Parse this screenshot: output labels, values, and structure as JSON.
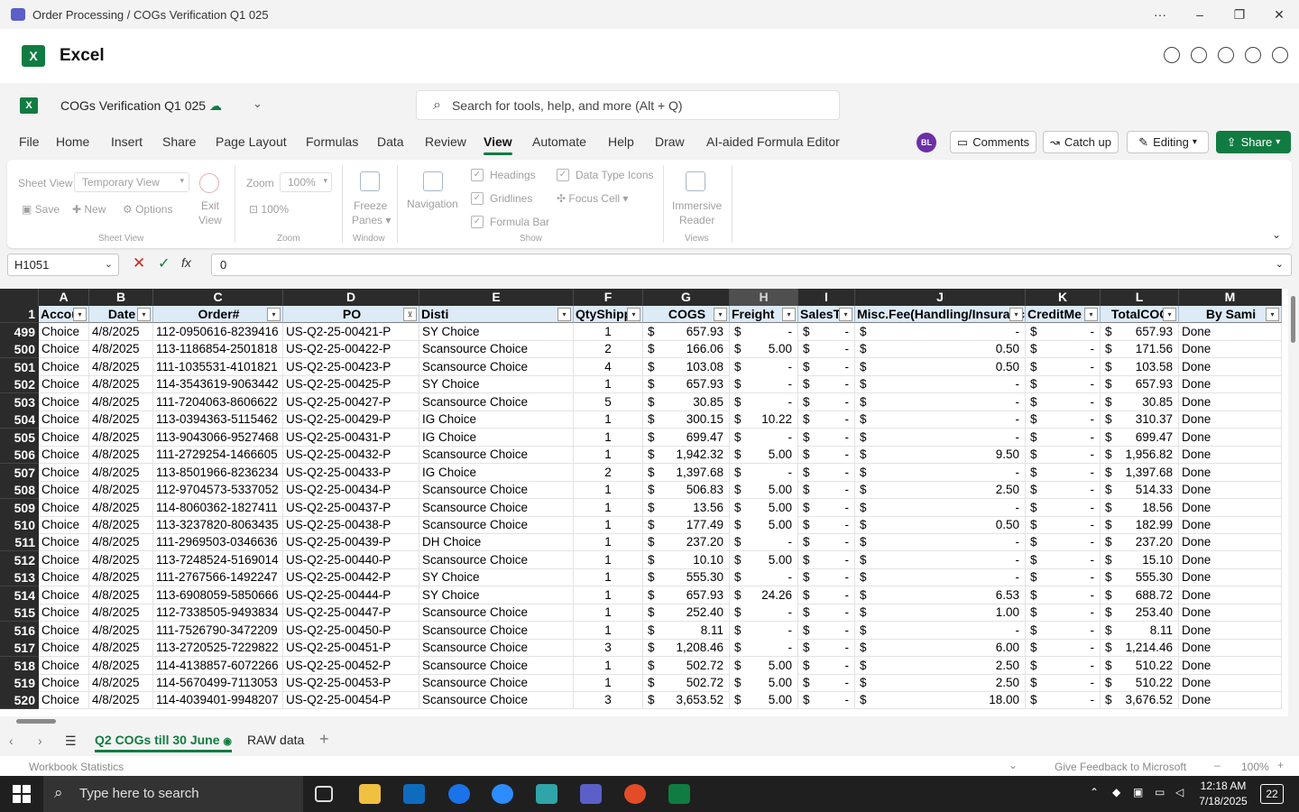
{
  "window": {
    "title": "Order Processing / COGs Verification Q1 025",
    "controls": [
      "···",
      "–",
      "❐",
      "✕"
    ]
  },
  "app": {
    "name": "Excel",
    "logo": "X"
  },
  "header_icons": [
    "comments-icon",
    "refresh-icon",
    "link-icon",
    "info-icon",
    "shield-icon"
  ],
  "doc": {
    "name": "COGs Verification Q1 025",
    "saved_icon": "cloud-saved-icon"
  },
  "search": {
    "placeholder": "Search for tools, help, and more (Alt + Q)"
  },
  "menu": [
    {
      "label": "File"
    },
    {
      "label": "Home"
    },
    {
      "label": "Insert"
    },
    {
      "label": "Share"
    },
    {
      "label": "Page Layout"
    },
    {
      "label": "Formulas"
    },
    {
      "label": "Data"
    },
    {
      "label": "Review"
    },
    {
      "label": "View",
      "active": true
    },
    {
      "label": "Automate"
    },
    {
      "label": "Help"
    },
    {
      "label": "Draw"
    },
    {
      "label": "AI-aided Formula Editor"
    }
  ],
  "user": {
    "initials": "BL",
    "color": "#6b2fa6"
  },
  "actions": {
    "comments": "Comments",
    "catchup": "Catch up",
    "editing": "Editing",
    "share": "Share"
  },
  "ribbon": {
    "sheet_view": {
      "label": "Sheet View",
      "value": "Temporary View",
      "save": "Save",
      "new": "New",
      "options": "Options",
      "exit": "Exit",
      "exit2": "View",
      "group": "Sheet View"
    },
    "zoom": {
      "label": "Zoom",
      "value": "100%",
      "hundred": "100%",
      "group": "Zoom"
    },
    "window": {
      "freeze": "Freeze",
      "freeze2": "Panes",
      "navigation": "Navigation",
      "group": "Window"
    },
    "show": {
      "headings": "Headings",
      "gridlines": "Gridlines",
      "formula_bar": "Formula Bar",
      "data_type_icons": "Data Type Icons",
      "focus_cell": "Focus Cell",
      "group": "Show"
    },
    "views": {
      "immersive": "Immersive",
      "reader": "Reader",
      "group": "Views"
    }
  },
  "formula_bar": {
    "name_box": "H1051",
    "value": "0"
  },
  "columns": [
    "A",
    "B",
    "C",
    "D",
    "E",
    "F",
    "G",
    "H",
    "I",
    "J",
    "K",
    "L",
    "M"
  ],
  "header_row": {
    "num": "1",
    "cells": [
      "Accou",
      "Date",
      "Order#",
      "PO",
      "Disti",
      "QtyShipp",
      "COGS",
      "Freight",
      "SalesTa",
      "Misc.Fee(Handling/Insuranc",
      "CreditMe",
      "TotalCOG",
      "By Sami"
    ]
  },
  "rows": [
    {
      "n": "499",
      "a": "Choice",
      "b": "4/8/2025",
      "c": "112-0950616-8239416",
      "d": "US-Q2-25-00421-P",
      "e": "SY Choice",
      "f": "1",
      "g": "657.93",
      "h": "-",
      "i": "-",
      "j": "-",
      "k": "-",
      "l": "657.93",
      "m": "Done"
    },
    {
      "n": "500",
      "a": "Choice",
      "b": "4/8/2025",
      "c": "113-1186854-2501818",
      "d": "US-Q2-25-00422-P",
      "e": "Scansource Choice",
      "f": "2",
      "g": "166.06",
      "h": "5.00",
      "i": "-",
      "j": "0.50",
      "k": "-",
      "l": "171.56",
      "m": "Done"
    },
    {
      "n": "501",
      "a": "Choice",
      "b": "4/8/2025",
      "c": "111-1035531-4101821",
      "d": "US-Q2-25-00423-P",
      "e": "Scansource Choice",
      "f": "4",
      "g": "103.08",
      "h": "-",
      "i": "-",
      "j": "0.50",
      "k": "-",
      "l": "103.58",
      "m": "Done"
    },
    {
      "n": "502",
      "a": "Choice",
      "b": "4/8/2025",
      "c": "114-3543619-9063442",
      "d": "US-Q2-25-00425-P",
      "e": "SY Choice",
      "f": "1",
      "g": "657.93",
      "h": "-",
      "i": "-",
      "j": "-",
      "k": "-",
      "l": "657.93",
      "m": "Done"
    },
    {
      "n": "503",
      "a": "Choice",
      "b": "4/8/2025",
      "c": "111-7204063-8606622",
      "d": "US-Q2-25-00427-P",
      "e": "Scansource Choice",
      "f": "5",
      "g": "30.85",
      "h": "-",
      "i": "-",
      "j": "-",
      "k": "-",
      "l": "30.85",
      "m": "Done"
    },
    {
      "n": "504",
      "a": "Choice",
      "b": "4/8/2025",
      "c": "113-0394363-5115462",
      "d": "US-Q2-25-00429-P",
      "e": "IG Choice",
      "f": "1",
      "g": "300.15",
      "h": "10.22",
      "i": "-",
      "j": "-",
      "k": "-",
      "l": "310.37",
      "m": "Done"
    },
    {
      "n": "505",
      "a": "Choice",
      "b": "4/8/2025",
      "c": "113-9043066-9527468",
      "d": "US-Q2-25-00431-P",
      "e": "IG Choice",
      "f": "1",
      "g": "699.47",
      "h": "-",
      "i": "-",
      "j": "-",
      "k": "-",
      "l": "699.47",
      "m": "Done"
    },
    {
      "n": "506",
      "a": "Choice",
      "b": "4/8/2025",
      "c": "111-2729254-1466605",
      "d": "US-Q2-25-00432-P",
      "e": "Scansource Choice",
      "f": "1",
      "g": "1,942.32",
      "h": "5.00",
      "i": "-",
      "j": "9.50",
      "k": "-",
      "l": "1,956.82",
      "m": "Done"
    },
    {
      "n": "507",
      "a": "Choice",
      "b": "4/8/2025",
      "c": "113-8501966-8236234",
      "d": "US-Q2-25-00433-P",
      "e": "IG Choice",
      "f": "2",
      "g": "1,397.68",
      "h": "-",
      "i": "-",
      "j": "-",
      "k": "-",
      "l": "1,397.68",
      "m": "Done"
    },
    {
      "n": "508",
      "a": "Choice",
      "b": "4/8/2025",
      "c": "112-9704573-5337052",
      "d": "US-Q2-25-00434-P",
      "e": "Scansource Choice",
      "f": "1",
      "g": "506.83",
      "h": "5.00",
      "i": "-",
      "j": "2.50",
      "k": "-",
      "l": "514.33",
      "m": "Done"
    },
    {
      "n": "509",
      "a": "Choice",
      "b": "4/8/2025",
      "c": "114-8060362-1827411",
      "d": "US-Q2-25-00437-P",
      "e": "Scansource Choice",
      "f": "1",
      "g": "13.56",
      "h": "5.00",
      "i": "-",
      "j": "-",
      "k": "-",
      "l": "18.56",
      "m": "Done"
    },
    {
      "n": "510",
      "a": "Choice",
      "b": "4/8/2025",
      "c": "113-3237820-8063435",
      "d": "US-Q2-25-00438-P",
      "e": "Scansource Choice",
      "f": "1",
      "g": "177.49",
      "h": "5.00",
      "i": "-",
      "j": "0.50",
      "k": "-",
      "l": "182.99",
      "m": "Done"
    },
    {
      "n": "511",
      "a": "Choice",
      "b": "4/8/2025",
      "c": "111-2969503-0346636",
      "d": "US-Q2-25-00439-P",
      "e": "DH Choice",
      "f": "1",
      "g": "237.20",
      "h": "-",
      "i": "-",
      "j": "-",
      "k": "-",
      "l": "237.20",
      "m": "Done"
    },
    {
      "n": "512",
      "a": "Choice",
      "b": "4/8/2025",
      "c": "113-7248524-5169014",
      "d": "US-Q2-25-00440-P",
      "e": "Scansource Choice",
      "f": "1",
      "g": "10.10",
      "h": "5.00",
      "i": "-",
      "j": "-",
      "k": "-",
      "l": "15.10",
      "m": "Done"
    },
    {
      "n": "513",
      "a": "Choice",
      "b": "4/8/2025",
      "c": "111-2767566-1492247",
      "d": "US-Q2-25-00442-P",
      "e": "SY Choice",
      "f": "1",
      "g": "555.30",
      "h": "-",
      "i": "-",
      "j": "-",
      "k": "-",
      "l": "555.30",
      "m": "Done"
    },
    {
      "n": "514",
      "a": "Choice",
      "b": "4/8/2025",
      "c": "113-6908059-5850666",
      "d": "US-Q2-25-00444-P",
      "e": "SY Choice",
      "f": "1",
      "g": "657.93",
      "h": "24.26",
      "i": "-",
      "j": "6.53",
      "k": "-",
      "l": "688.72",
      "m": "Done"
    },
    {
      "n": "515",
      "a": "Choice",
      "b": "4/8/2025",
      "c": "112-7338505-9493834",
      "d": "US-Q2-25-00447-P",
      "e": "Scansource Choice",
      "f": "1",
      "g": "252.40",
      "h": "-",
      "i": "-",
      "j": "1.00",
      "k": "-",
      "l": "253.40",
      "m": "Done"
    },
    {
      "n": "516",
      "a": "Choice",
      "b": "4/8/2025",
      "c": "111-7526790-3472209",
      "d": "US-Q2-25-00450-P",
      "e": "Scansource Choice",
      "f": "1",
      "g": "8.11",
      "h": "-",
      "i": "-",
      "j": "-",
      "k": "-",
      "l": "8.11",
      "m": "Done"
    },
    {
      "n": "517",
      "a": "Choice",
      "b": "4/8/2025",
      "c": "113-2720525-7229822",
      "d": "US-Q2-25-00451-P",
      "e": "Scansource Choice",
      "f": "3",
      "g": "1,208.46",
      "h": "-",
      "i": "-",
      "j": "6.00",
      "k": "-",
      "l": "1,214.46",
      "m": "Done"
    },
    {
      "n": "518",
      "a": "Choice",
      "b": "4/8/2025",
      "c": "114-4138857-6072266",
      "d": "US-Q2-25-00452-P",
      "e": "Scansource Choice",
      "f": "1",
      "g": "502.72",
      "h": "5.00",
      "i": "-",
      "j": "2.50",
      "k": "-",
      "l": "510.22",
      "m": "Done"
    },
    {
      "n": "519",
      "a": "Choice",
      "b": "4/8/2025",
      "c": "114-5670499-7113053",
      "d": "US-Q2-25-00453-P",
      "e": "Scansource Choice",
      "f": "1",
      "g": "502.72",
      "h": "5.00",
      "i": "-",
      "j": "2.50",
      "k": "-",
      "l": "510.22",
      "m": "Done"
    },
    {
      "n": "520",
      "a": "Choice",
      "b": "4/8/2025",
      "c": "114-4039401-9948207",
      "d": "US-Q2-25-00454-P",
      "e": "Scansource Choice",
      "f": "3",
      "g": "3,653.52",
      "h": "5.00",
      "i": "-",
      "j": "18.00",
      "k": "-",
      "l": "3,676.52",
      "m": "Done"
    }
  ],
  "sheet_tabs": [
    {
      "label": "Q2 COGs till 30 June",
      "active": true
    },
    {
      "label": "RAW data"
    }
  ],
  "status": {
    "left": "Workbook Statistics",
    "feedback": "Give Feedback to Microsoft",
    "zoom": "100%"
  },
  "taskbar": {
    "search": "Type here to search",
    "time": "12:18 AM",
    "date": "7/18/2025",
    "notifications": "22"
  }
}
